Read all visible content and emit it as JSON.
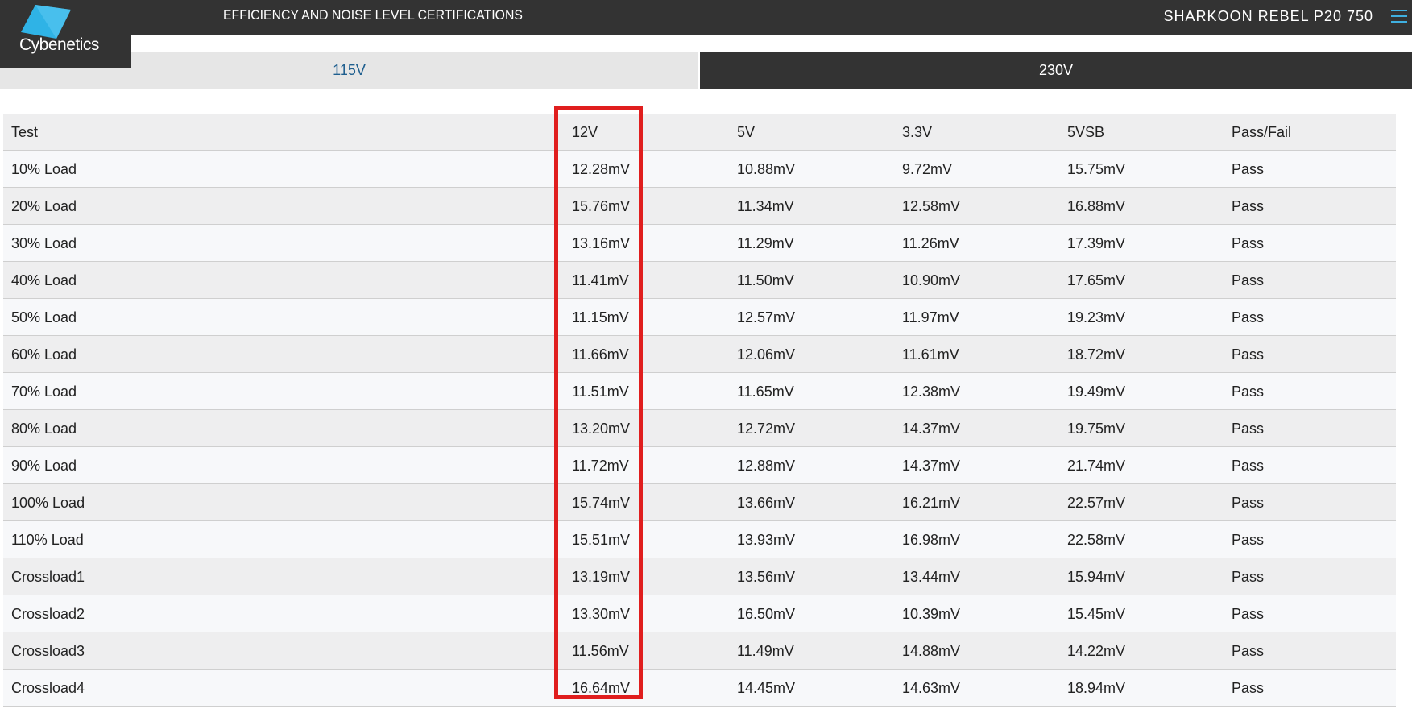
{
  "header": {
    "title": "EFFICIENCY AND NOISE LEVEL CERTIFICATIONS",
    "product": "SHARKOON REBEL P20 750",
    "logo_text": "Cybenetics"
  },
  "tabs": [
    {
      "label": "115V",
      "active": false
    },
    {
      "label": "230V",
      "active": true
    }
  ],
  "table": {
    "headers": [
      "Test",
      "12V",
      "5V",
      "3.3V",
      "5VSB",
      "Pass/Fail"
    ],
    "rows": [
      [
        "10% Load",
        "12.28mV",
        "10.88mV",
        "9.72mV",
        "15.75mV",
        "Pass"
      ],
      [
        "20% Load",
        "15.76mV",
        "11.34mV",
        "12.58mV",
        "16.88mV",
        "Pass"
      ],
      [
        "30% Load",
        "13.16mV",
        "11.29mV",
        "11.26mV",
        "17.39mV",
        "Pass"
      ],
      [
        "40% Load",
        "11.41mV",
        "11.50mV",
        "10.90mV",
        "17.65mV",
        "Pass"
      ],
      [
        "50% Load",
        "11.15mV",
        "12.57mV",
        "11.97mV",
        "19.23mV",
        "Pass"
      ],
      [
        "60% Load",
        "11.66mV",
        "12.06mV",
        "11.61mV",
        "18.72mV",
        "Pass"
      ],
      [
        "70% Load",
        "11.51mV",
        "11.65mV",
        "12.38mV",
        "19.49mV",
        "Pass"
      ],
      [
        "80% Load",
        "13.20mV",
        "12.72mV",
        "14.37mV",
        "19.75mV",
        "Pass"
      ],
      [
        "90% Load",
        "11.72mV",
        "12.88mV",
        "14.37mV",
        "21.74mV",
        "Pass"
      ],
      [
        "100% Load",
        "15.74mV",
        "13.66mV",
        "16.21mV",
        "22.57mV",
        "Pass"
      ],
      [
        "110% Load",
        "15.51mV",
        "13.93mV",
        "16.98mV",
        "22.58mV",
        "Pass"
      ],
      [
        "Crossload1",
        "13.19mV",
        "13.56mV",
        "13.44mV",
        "15.94mV",
        "Pass"
      ],
      [
        "Crossload2",
        "13.30mV",
        "16.50mV",
        "10.39mV",
        "15.45mV",
        "Pass"
      ],
      [
        "Crossload3",
        "11.56mV",
        "11.49mV",
        "14.88mV",
        "14.22mV",
        "Pass"
      ],
      [
        "Crossload4",
        "16.64mV",
        "14.45mV",
        "14.63mV",
        "18.94mV",
        "Pass"
      ]
    ]
  },
  "colors": {
    "header_bg": "#333333",
    "accent": "#3fb0e0",
    "highlight": "#e01e1e",
    "tab_inactive_text": "#1f5f8f"
  }
}
